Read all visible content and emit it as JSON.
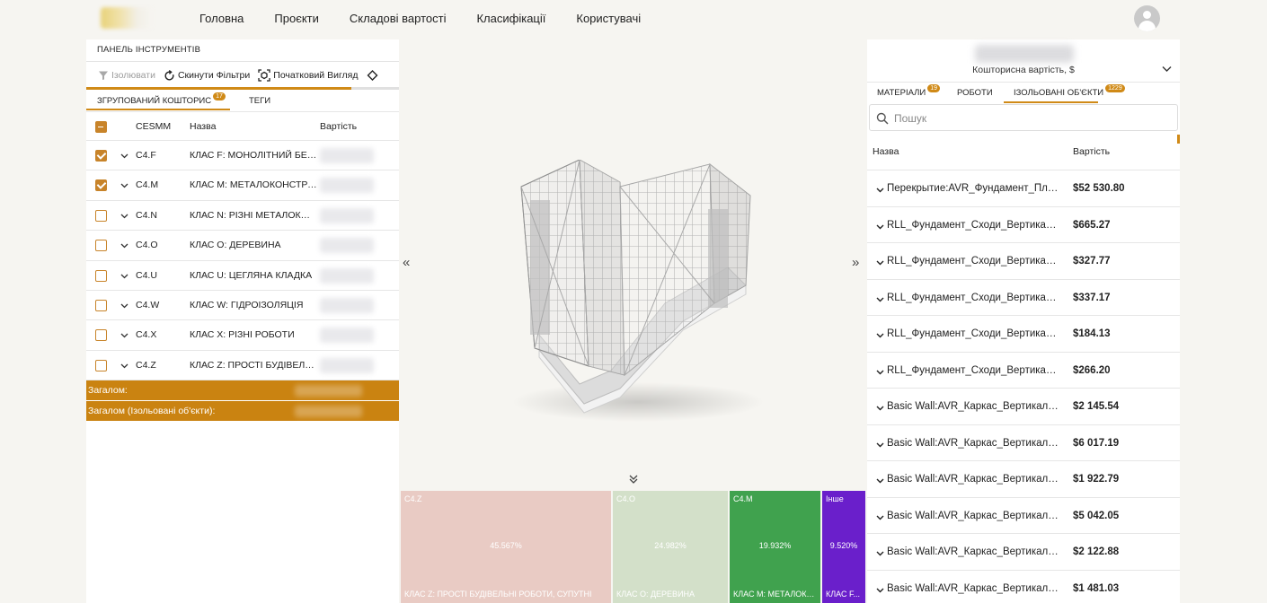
{
  "nav": {
    "items": [
      "Головна",
      "Проєкти",
      "Складові вартості",
      "Класифікації",
      "Користувачі"
    ]
  },
  "left_panel": {
    "title": "ПАНЕЛЬ ІНСТРУМЕНТІВ",
    "toolbar": {
      "isolate": "Ізолювати",
      "reset_filters": "Скинути Фільтри",
      "initial_view": "Початковий Вигляд"
    },
    "tabs": {
      "grouped": "ЗГРУПОВАНИЙ КОШТОРИС",
      "grouped_badge": "17",
      "tags": "ТЕГИ"
    },
    "columns": {
      "code": "CESMM",
      "name": "Назва",
      "cost": "Вартість"
    },
    "rows": [
      {
        "code": "C4.F",
        "name": "КЛАС F: МОНОЛІТНИЙ БЕТОН",
        "checked": true
      },
      {
        "code": "C4.M",
        "name": "КЛАС M: МЕТАЛОКОНСТРУКЦІЇ",
        "checked": true
      },
      {
        "code": "C4.N",
        "name": "КЛАС N: РІЗНІ МЕТАЛОКОНСТРУКЦІЇ",
        "checked": false
      },
      {
        "code": "C4.O",
        "name": "КЛАС O: ДЕРЕВИНА",
        "checked": false
      },
      {
        "code": "C4.U",
        "name": "КЛАС U: ЦЕГЛЯНА КЛАДКА",
        "checked": false
      },
      {
        "code": "C4.W",
        "name": "КЛАС W: ГІДРОІЗОЛЯЦІЯ",
        "checked": false
      },
      {
        "code": "C4.X",
        "name": "КЛАС X: РІЗНІ РОБОТИ",
        "checked": false
      },
      {
        "code": "C4.Z",
        "name": "КЛАС Z: ПРОСТІ БУДІВЕЛЬНІ РОБОТИ",
        "checked": false
      }
    ],
    "total_label": "Загалом:",
    "total_isolated_label": "Загалом (Ізольовані об'єкти):"
  },
  "treemap": [
    {
      "code": "C4.Z",
      "percent": "45.567%",
      "label": "КЛАС Z: ПРОСТІ БУДІВЕЛЬНІ РОБОТИ, СУПУТНІ",
      "color": "#e9cbc4"
    },
    {
      "code": "C4.O",
      "percent": "24.982%",
      "label": "КЛАС O: ДЕРЕВИНА",
      "color": "#d3e0c9"
    },
    {
      "code": "C4.M",
      "percent": "19.932%",
      "label": "КЛАС M: МЕТАЛОКОНСТРУКЦІЇ",
      "color": "#40a24e"
    },
    {
      "code": "Інше",
      "percent": "9.520%",
      "label": "КЛАС F...",
      "color": "#6a1fcb"
    }
  ],
  "right_panel": {
    "cost_label": "Кошторисна вартість, $",
    "tabs": {
      "materials": "МАТЕРІАЛИ",
      "materials_badge": "19",
      "works": "РОБОТИ",
      "isolated": "ІЗОЛЬОВАНІ ОБ'ЄКТИ",
      "isolated_badge": "1229"
    },
    "search_placeholder": "Пошук",
    "columns": {
      "name": "Назва",
      "cost": "Вартість"
    },
    "rows": [
      {
        "name": "Перекрытие:AVR_Фундамент_Плита",
        "cost": "$52 530.80"
      },
      {
        "name": "RLL_Фундамент_Сходи_Вертикальні",
        "cost": "$665.27"
      },
      {
        "name": "RLL_Фундамент_Сходи_Вертикальні",
        "cost": "$327.77"
      },
      {
        "name": "RLL_Фундамент_Сходи_Вертикальні",
        "cost": "$337.17"
      },
      {
        "name": "RLL_Фундамент_Сходи_Вертикальні",
        "cost": "$184.13"
      },
      {
        "name": "RLL_Фундамент_Сходи_Вертикальні",
        "cost": "$266.20"
      },
      {
        "name": "Basic Wall:AVR_Каркас_Вертикальний",
        "cost": "$2 145.54"
      },
      {
        "name": "Basic Wall:AVR_Каркас_Вертикальний",
        "cost": "$6 017.19"
      },
      {
        "name": "Basic Wall:AVR_Каркас_Вертикальний",
        "cost": "$1 922.79"
      },
      {
        "name": "Basic Wall:AVR_Каркас_Вертикальний",
        "cost": "$5 042.05"
      },
      {
        "name": "Basic Wall:AVR_Каркас_Вертикальний",
        "cost": "$2 122.88"
      },
      {
        "name": "Basic Wall:AVR_Каркас_Вертикальний",
        "cost": "$1 481.03"
      }
    ]
  },
  "colors": {
    "accent": "#d08a17",
    "total_bar": "#ca8311"
  }
}
